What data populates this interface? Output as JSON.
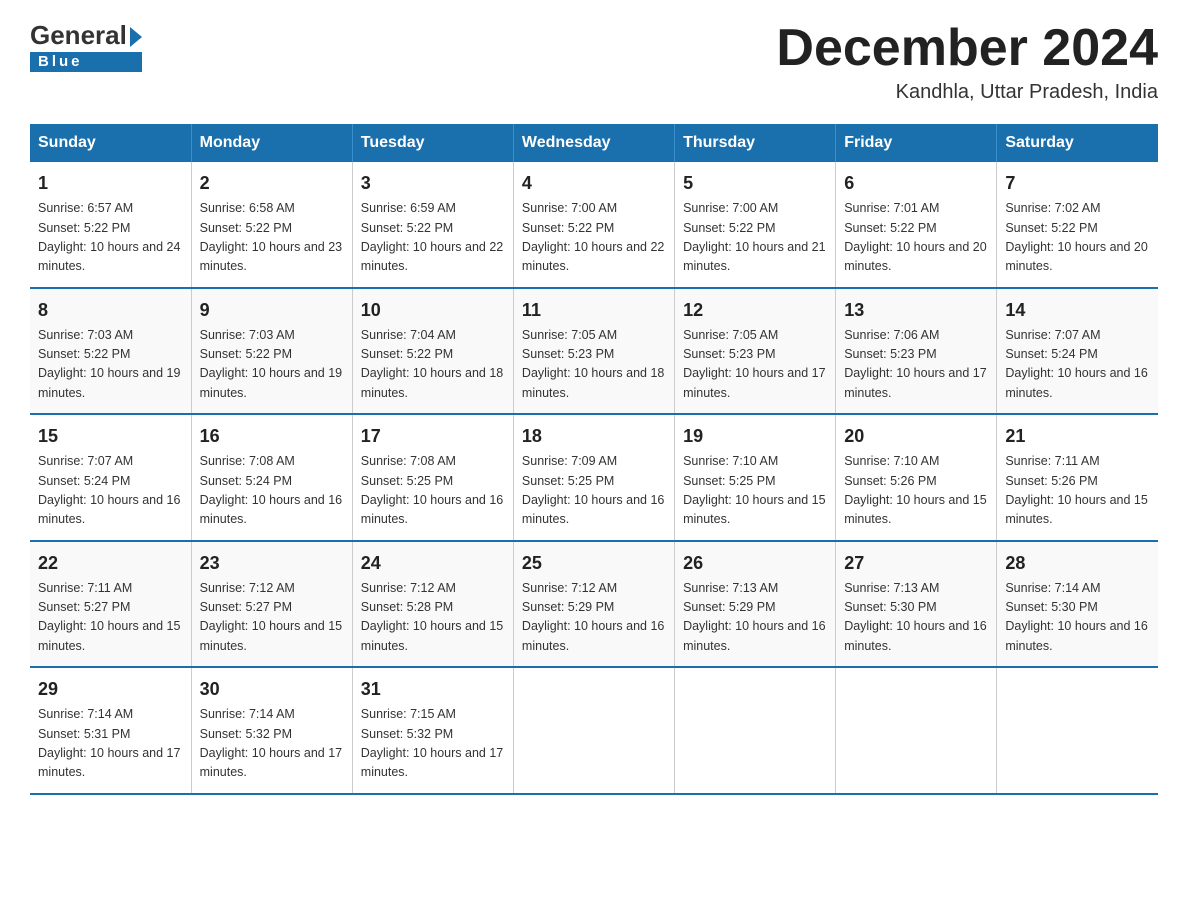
{
  "logo": {
    "general": "General",
    "blue": "Blue"
  },
  "header": {
    "title": "December 2024",
    "subtitle": "Kandhla, Uttar Pradesh, India"
  },
  "days": [
    "Sunday",
    "Monday",
    "Tuesday",
    "Wednesday",
    "Thursday",
    "Friday",
    "Saturday"
  ],
  "weeks": [
    [
      {
        "num": "1",
        "sunrise": "6:57 AM",
        "sunset": "5:22 PM",
        "daylight": "10 hours and 24 minutes."
      },
      {
        "num": "2",
        "sunrise": "6:58 AM",
        "sunset": "5:22 PM",
        "daylight": "10 hours and 23 minutes."
      },
      {
        "num": "3",
        "sunrise": "6:59 AM",
        "sunset": "5:22 PM",
        "daylight": "10 hours and 22 minutes."
      },
      {
        "num": "4",
        "sunrise": "7:00 AM",
        "sunset": "5:22 PM",
        "daylight": "10 hours and 22 minutes."
      },
      {
        "num": "5",
        "sunrise": "7:00 AM",
        "sunset": "5:22 PM",
        "daylight": "10 hours and 21 minutes."
      },
      {
        "num": "6",
        "sunrise": "7:01 AM",
        "sunset": "5:22 PM",
        "daylight": "10 hours and 20 minutes."
      },
      {
        "num": "7",
        "sunrise": "7:02 AM",
        "sunset": "5:22 PM",
        "daylight": "10 hours and 20 minutes."
      }
    ],
    [
      {
        "num": "8",
        "sunrise": "7:03 AM",
        "sunset": "5:22 PM",
        "daylight": "10 hours and 19 minutes."
      },
      {
        "num": "9",
        "sunrise": "7:03 AM",
        "sunset": "5:22 PM",
        "daylight": "10 hours and 19 minutes."
      },
      {
        "num": "10",
        "sunrise": "7:04 AM",
        "sunset": "5:22 PM",
        "daylight": "10 hours and 18 minutes."
      },
      {
        "num": "11",
        "sunrise": "7:05 AM",
        "sunset": "5:23 PM",
        "daylight": "10 hours and 18 minutes."
      },
      {
        "num": "12",
        "sunrise": "7:05 AM",
        "sunset": "5:23 PM",
        "daylight": "10 hours and 17 minutes."
      },
      {
        "num": "13",
        "sunrise": "7:06 AM",
        "sunset": "5:23 PM",
        "daylight": "10 hours and 17 minutes."
      },
      {
        "num": "14",
        "sunrise": "7:07 AM",
        "sunset": "5:24 PM",
        "daylight": "10 hours and 16 minutes."
      }
    ],
    [
      {
        "num": "15",
        "sunrise": "7:07 AM",
        "sunset": "5:24 PM",
        "daylight": "10 hours and 16 minutes."
      },
      {
        "num": "16",
        "sunrise": "7:08 AM",
        "sunset": "5:24 PM",
        "daylight": "10 hours and 16 minutes."
      },
      {
        "num": "17",
        "sunrise": "7:08 AM",
        "sunset": "5:25 PM",
        "daylight": "10 hours and 16 minutes."
      },
      {
        "num": "18",
        "sunrise": "7:09 AM",
        "sunset": "5:25 PM",
        "daylight": "10 hours and 16 minutes."
      },
      {
        "num": "19",
        "sunrise": "7:10 AM",
        "sunset": "5:25 PM",
        "daylight": "10 hours and 15 minutes."
      },
      {
        "num": "20",
        "sunrise": "7:10 AM",
        "sunset": "5:26 PM",
        "daylight": "10 hours and 15 minutes."
      },
      {
        "num": "21",
        "sunrise": "7:11 AM",
        "sunset": "5:26 PM",
        "daylight": "10 hours and 15 minutes."
      }
    ],
    [
      {
        "num": "22",
        "sunrise": "7:11 AM",
        "sunset": "5:27 PM",
        "daylight": "10 hours and 15 minutes."
      },
      {
        "num": "23",
        "sunrise": "7:12 AM",
        "sunset": "5:27 PM",
        "daylight": "10 hours and 15 minutes."
      },
      {
        "num": "24",
        "sunrise": "7:12 AM",
        "sunset": "5:28 PM",
        "daylight": "10 hours and 15 minutes."
      },
      {
        "num": "25",
        "sunrise": "7:12 AM",
        "sunset": "5:29 PM",
        "daylight": "10 hours and 16 minutes."
      },
      {
        "num": "26",
        "sunrise": "7:13 AM",
        "sunset": "5:29 PM",
        "daylight": "10 hours and 16 minutes."
      },
      {
        "num": "27",
        "sunrise": "7:13 AM",
        "sunset": "5:30 PM",
        "daylight": "10 hours and 16 minutes."
      },
      {
        "num": "28",
        "sunrise": "7:14 AM",
        "sunset": "5:30 PM",
        "daylight": "10 hours and 16 minutes."
      }
    ],
    [
      {
        "num": "29",
        "sunrise": "7:14 AM",
        "sunset": "5:31 PM",
        "daylight": "10 hours and 17 minutes."
      },
      {
        "num": "30",
        "sunrise": "7:14 AM",
        "sunset": "5:32 PM",
        "daylight": "10 hours and 17 minutes."
      },
      {
        "num": "31",
        "sunrise": "7:15 AM",
        "sunset": "5:32 PM",
        "daylight": "10 hours and 17 minutes."
      },
      null,
      null,
      null,
      null
    ]
  ],
  "labels": {
    "sunrise": "Sunrise: ",
    "sunset": "Sunset: ",
    "daylight": "Daylight: "
  }
}
